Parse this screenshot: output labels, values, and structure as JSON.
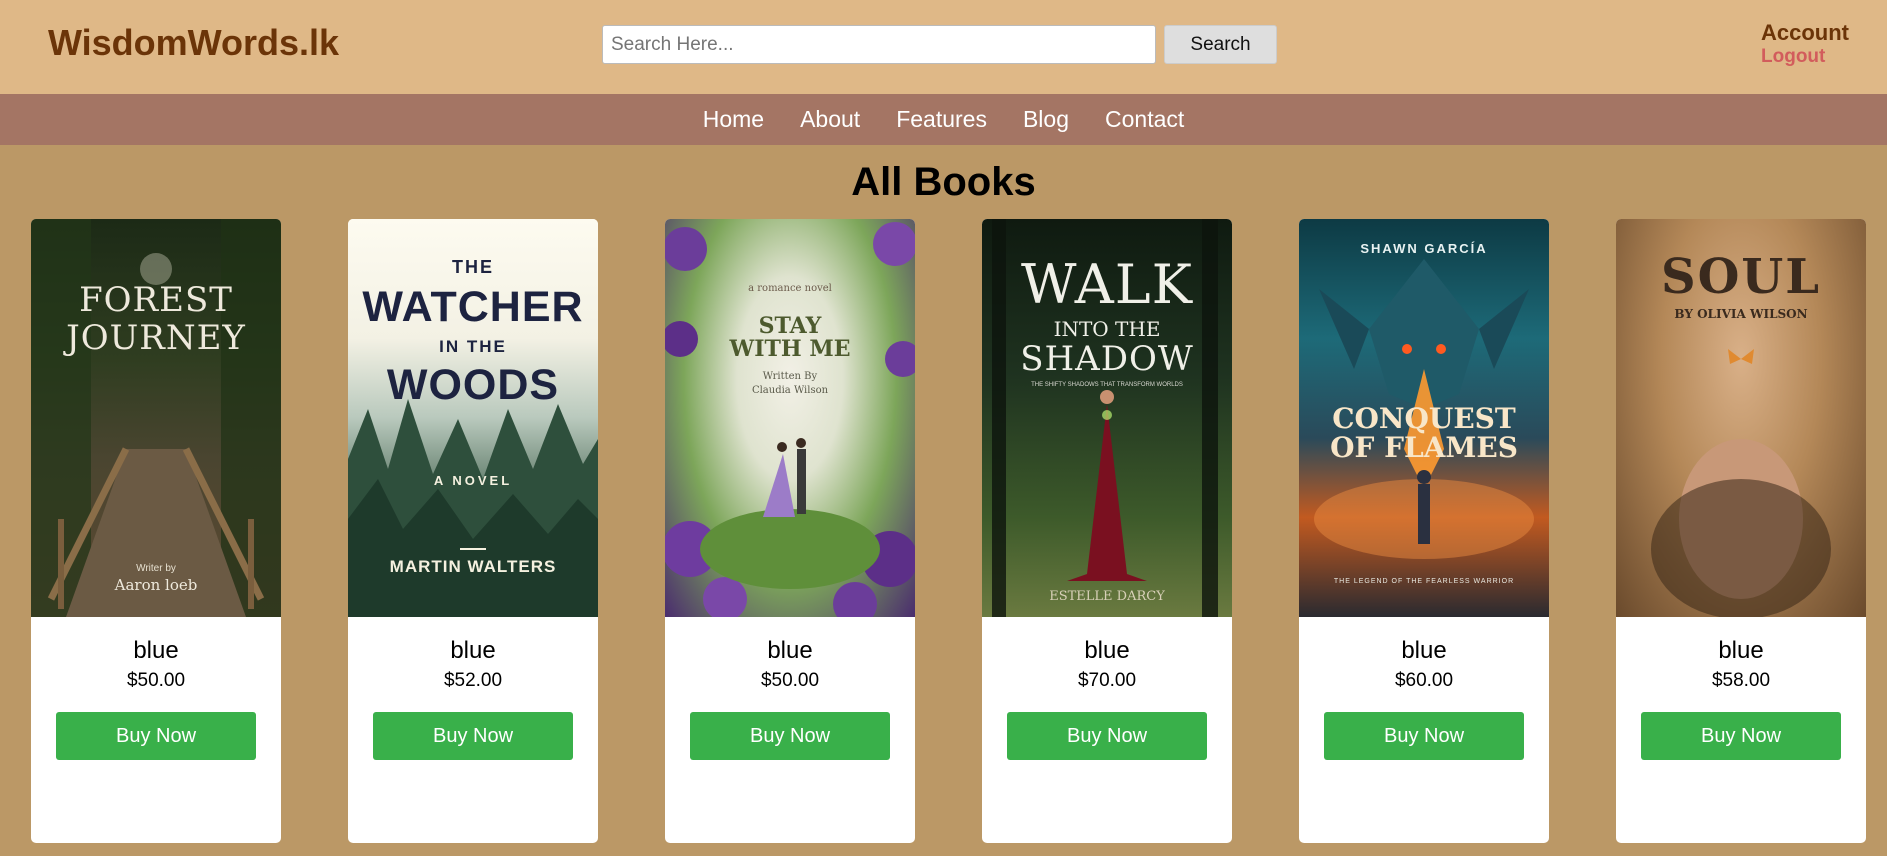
{
  "header": {
    "logo": "WisdomWords.lk",
    "search_placeholder": "Search Here...",
    "search_button": "Search",
    "account": "Account",
    "logout": "Logout"
  },
  "nav": {
    "items": [
      {
        "label": "Home"
      },
      {
        "label": "About"
      },
      {
        "label": "Features"
      },
      {
        "label": "Blog"
      },
      {
        "label": "Contact"
      }
    ]
  },
  "main": {
    "title": "All Books",
    "books": [
      {
        "name": "blue",
        "price": "$50.00",
        "buy": "Buy Now",
        "cover": {
          "lines": [
            "FOREST",
            "JOURNEY"
          ],
          "author_label": "Writer by",
          "author": "Aaron loeb"
        }
      },
      {
        "name": "blue",
        "price": "$52.00",
        "buy": "Buy Now",
        "cover": {
          "lines": [
            "THE",
            "WATCHER",
            "IN THE",
            "WOODS"
          ],
          "tag": "A NOVEL",
          "author": "MARTIN WALTERS"
        }
      },
      {
        "name": "blue",
        "price": "$50.00",
        "buy": "Buy Now",
        "cover": {
          "tag": "a romance novel",
          "lines": [
            "STAY",
            "WITH ME"
          ],
          "author_label": "Written By",
          "author": "Claudia Wilson"
        }
      },
      {
        "name": "blue",
        "price": "$70.00",
        "buy": "Buy Now",
        "cover": {
          "lines": [
            "WALK",
            "INTO THE",
            "SHADOW"
          ],
          "tag": "THE SHIFTY SHADOWS THAT TRANSFORM WORLDS",
          "author": "ESTELLE DARCY"
        }
      },
      {
        "name": "blue",
        "price": "$60.00",
        "buy": "Buy Now",
        "cover": {
          "author": "SHAWN GARCÍA",
          "lines": [
            "CONQUEST",
            "OF FLAMES"
          ],
          "tag": "THE LEGEND OF THE FEARLESS WARRIOR"
        }
      },
      {
        "name": "blue",
        "price": "$58.00",
        "buy": "Buy Now",
        "cover": {
          "lines": [
            "SOUL"
          ],
          "author": "BY OLIVIA WILSON"
        }
      }
    ]
  },
  "colors": {
    "header_bg": "#dfb887",
    "nav_bg": "#a47564",
    "page_bg": "#bb9866",
    "logo": "#6b3408",
    "logout": "#d25c5c",
    "buy_button": "#39b04a"
  }
}
